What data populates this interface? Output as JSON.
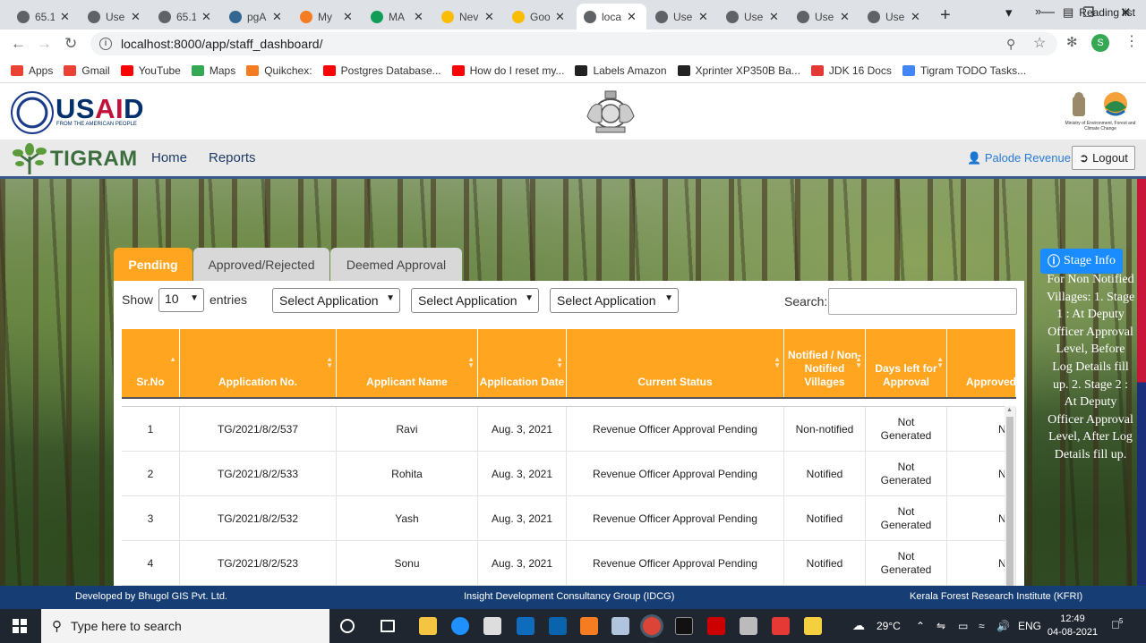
{
  "browser": {
    "tabs": [
      {
        "label": "65.1",
        "color": "#5f6368"
      },
      {
        "label": "Use",
        "color": "#5f6368"
      },
      {
        "label": "65.1",
        "color": "#5f6368"
      },
      {
        "label": "pgA",
        "color": "#336791"
      },
      {
        "label": "My",
        "color": "#f57c20"
      },
      {
        "label": "MA",
        "color": "#0f9d58"
      },
      {
        "label": "Nev",
        "color": "#fbbc04"
      },
      {
        "label": "Goo",
        "color": "#fbbc04"
      },
      {
        "label": "loca",
        "color": "#5f6368"
      },
      {
        "label": "Use",
        "color": "#5f6368"
      },
      {
        "label": "Use",
        "color": "#5f6368"
      },
      {
        "label": "Use",
        "color": "#5f6368"
      },
      {
        "label": "Use",
        "color": "#5f6368"
      }
    ],
    "active_tab_index": 8,
    "url": "localhost:8000/app/staff_dashboard/",
    "profile_initial": "S"
  },
  "bookmarks": [
    {
      "label": "Apps",
      "color": "#ea4335"
    },
    {
      "label": "Gmail",
      "color": "#ea4335"
    },
    {
      "label": "YouTube",
      "color": "#ff0000"
    },
    {
      "label": "Maps",
      "color": "#34a853"
    },
    {
      "label": "Quikchex:",
      "color": "#f57c20"
    },
    {
      "label": "Postgres Database...",
      "color": "#ff0000"
    },
    {
      "label": "How do I reset my...",
      "color": "#ff0000"
    },
    {
      "label": "Labels Amazon",
      "color": "#222222"
    },
    {
      "label": "Xprinter XP350B Ba...",
      "color": "#222222"
    },
    {
      "label": "JDK 16 Docs",
      "color": "#e53935"
    },
    {
      "label": "Tigram TODO Tasks...",
      "color": "#4285f4"
    }
  ],
  "bookmarks_more": "»",
  "reading_list": "Reading list",
  "header": {
    "usaid_left": "US",
    "usaid_accent": "AI",
    "usaid_right": "D",
    "usaid_tagline": "FROM THE AMERICAN PEOPLE",
    "moef_text": "Ministry of Environment, Forest and Climate Change"
  },
  "nav": {
    "brand": "TIGRAM",
    "home": "Home",
    "reports": "Reports",
    "user": "Palode Revenue",
    "logout": "Logout"
  },
  "tabs": {
    "pending": "Pending",
    "approved_rejected": "Approved/Rejected",
    "deemed": "Deemed Approval"
  },
  "controls": {
    "show": "Show",
    "page_size": "10",
    "entries": "entries",
    "select1": "Select Application",
    "select2": "Select Application",
    "select3": "Select Application",
    "search": "Search:"
  },
  "table": {
    "headers": [
      "Sr.No",
      "Application No.",
      "Applicant Name",
      "Application Date",
      "Current Status",
      "Notified / Non-Notified Villages",
      "Days left for Approval",
      "Approved"
    ],
    "rows": [
      [
        "1",
        "TG/2021/8/2/537",
        "Ravi",
        "Aug. 3, 2021",
        "Revenue Officer Approval Pending",
        "Non-notified",
        "Not Generated",
        "N"
      ],
      [
        "2",
        "TG/2021/8/2/533",
        "Rohita",
        "Aug. 3, 2021",
        "Revenue Officer Approval Pending",
        "Notified",
        "Not Generated",
        "N"
      ],
      [
        "3",
        "TG/2021/8/2/532",
        "Yash",
        "Aug. 3, 2021",
        "Revenue Officer Approval Pending",
        "Notified",
        "Not Generated",
        "N"
      ],
      [
        "4",
        "TG/2021/8/2/523",
        "Sonu",
        "Aug. 3, 2021",
        "Revenue Officer Approval Pending",
        "Notified",
        "Not Generated",
        "N"
      ]
    ]
  },
  "stage_info": {
    "button": "Stage Info",
    "text": "For Non Notified Villages: 1. Stage 1 : At Deputy Officer Approval Level, Before Log Details fill up. 2. Stage 2 : At Deputy Officer Approval Level, After Log Details fill up."
  },
  "footer": {
    "left": "Developed by Bhugol GIS Pvt. Ltd.",
    "center": "Insight Development Consultancy Group (IDCG)",
    "right": "Kerala Forest Research Institute (KFRI)"
  },
  "taskbar": {
    "search_placeholder": "Type here to search",
    "weather": "29°C",
    "lang": "ENG",
    "time": "12:49",
    "date": "04-08-2021",
    "notifications": "5"
  }
}
